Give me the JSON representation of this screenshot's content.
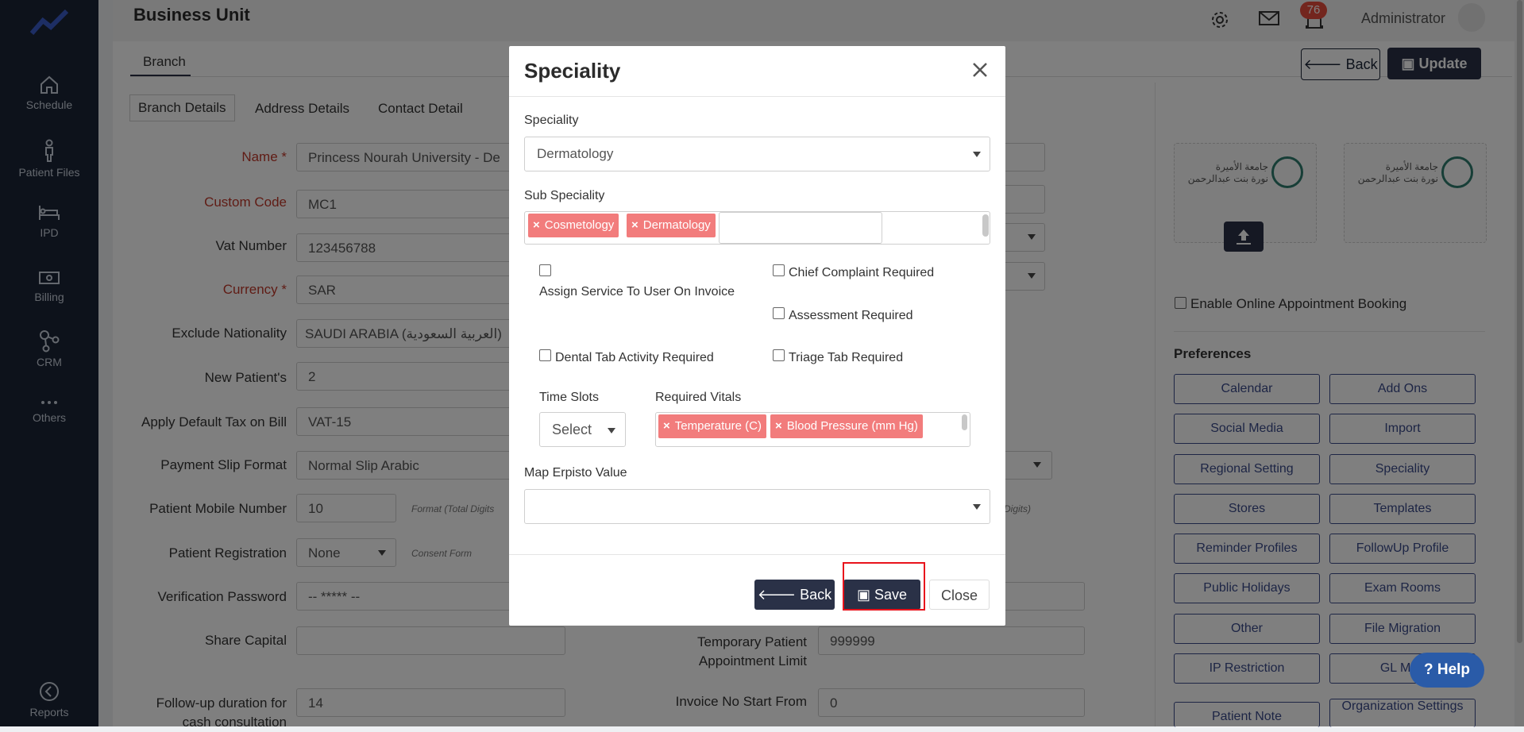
{
  "sidebar": {
    "items": [
      {
        "label": "Schedule",
        "icon": "home-icon"
      },
      {
        "label": "Patient Files",
        "icon": "person-icon"
      },
      {
        "label": "IPD",
        "icon": "bed-icon"
      },
      {
        "label": "Billing",
        "icon": "money-icon"
      },
      {
        "label": "CRM",
        "icon": "network-icon"
      },
      {
        "label": "Others",
        "icon": "more-icon"
      },
      {
        "label": "Reports",
        "icon": "reports-icon"
      }
    ]
  },
  "header": {
    "title": "Business Unit",
    "notification_count": "76",
    "user": "Administrator"
  },
  "tabs": {
    "main": "Branch",
    "sub": [
      "Branch Details",
      "Address Details",
      "Contact Detail"
    ]
  },
  "actions": {
    "back": "Back",
    "update": "Update"
  },
  "form": {
    "fields": [
      {
        "label": "Name *",
        "value": "Princess Nourah University - De",
        "required": true
      },
      {
        "label": "Custom Code",
        "value": "MC1",
        "required": true
      },
      {
        "label": "Vat Number",
        "value": "123456788"
      },
      {
        "label": "Currency *",
        "value": "SAR",
        "required": true
      },
      {
        "label": "Exclude Nationality",
        "value": "SAUDI ARABIA (العربية السعودية)"
      },
      {
        "label": "New Patient's",
        "value": "2"
      },
      {
        "label": "Apply Default Tax on Bill",
        "value": "VAT-15"
      },
      {
        "label": "Payment Slip Format",
        "value": "Normal Slip Arabic"
      },
      {
        "label": "Patient Mobile Number",
        "value": "10"
      },
      {
        "label": "Patient Registration",
        "value": "None"
      },
      {
        "label": "Verification Password",
        "value": "-- ***** --"
      },
      {
        "label": "Share Capital",
        "value": ""
      },
      {
        "label": "Follow-up duration for cash consultation",
        "value": "14"
      }
    ],
    "hints": {
      "mobile": "Format (Total Digits",
      "mobile_right": "Digits)",
      "consent": "Consent Form"
    },
    "right_fields": [
      {
        "label": "Temporary Patient Appointment Limit",
        "value": "999999"
      },
      {
        "label": "Invoice No Start From",
        "value": "0"
      }
    ]
  },
  "right_panel": {
    "logo_text": "جامعة الأميرة\nنورة بنت عبدالرحمن",
    "online_booking": "Enable Online Appointment Booking",
    "preferences_title": "Preferences",
    "preferences": [
      "Calendar",
      "Add Ons",
      "Social Media",
      "Import",
      "Regional Setting",
      "Speciality",
      "Stores",
      "Templates",
      "Reminder Profiles",
      "FollowUp Profile",
      "Public Holidays",
      "Exam Rooms",
      "Other",
      "File Migration",
      "IP Restriction",
      "GL Map",
      "Patient Note",
      "Organization Settings"
    ]
  },
  "help": "Help",
  "modal": {
    "title": "Speciality",
    "speciality_label": "Speciality",
    "speciality_value": "Dermatology",
    "sub_speciality_label": "Sub Speciality",
    "sub_tags": [
      "Cosmetology",
      "Dermatology"
    ],
    "checkboxes": {
      "assign_service": "Assign Service To User On Invoice",
      "chief_complaint": "Chief Complaint Required",
      "assessment": "Assessment Required",
      "dental_tab": "Dental Tab Activity Required",
      "triage_tab": "Triage Tab Required"
    },
    "time_slots_label": "Time Slots",
    "time_slots_value": "Select",
    "vitals_label": "Required Vitals",
    "vitals_tags": [
      "Temperature (C)",
      "Blood Pressure (mm Hg)"
    ],
    "map_label": "Map Erpisto Value",
    "map_value": "",
    "buttons": {
      "back": "Back",
      "save": "Save",
      "close": "Close"
    }
  },
  "colors": {
    "sidebar": "#1b2436",
    "tag": "#f27c7c",
    "primary": "#2a3147",
    "highlight": "#e8131c"
  }
}
